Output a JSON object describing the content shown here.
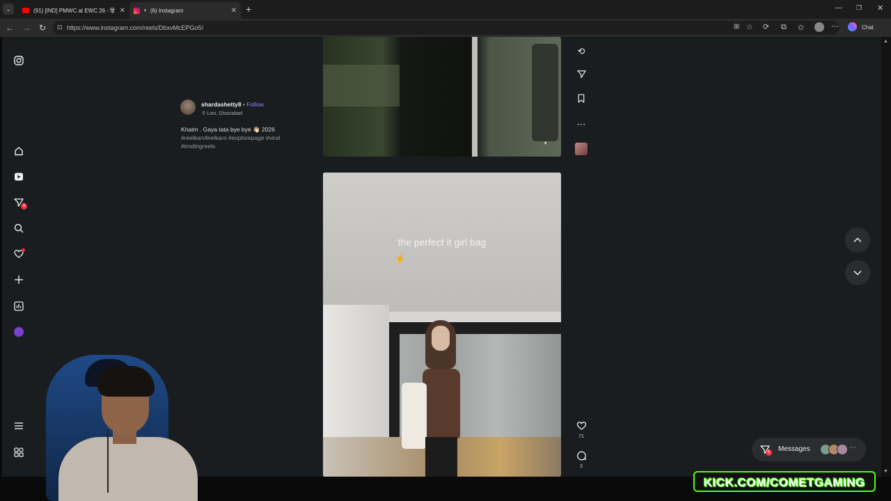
{
  "browser": {
    "tabs": [
      {
        "title": "(91) [IND] PMWC at EWC 26 - हिं",
        "active": false
      },
      {
        "title": "(6) Instagram",
        "active": true
      }
    ],
    "url": "https://www.instagram.com/reels/DbxvMcEPGo5/",
    "chat_label": "Chat"
  },
  "sidebar": {
    "items": [
      {
        "icon": "instagram-logo-icon"
      },
      {
        "icon": "home-icon"
      },
      {
        "icon": "reels-icon"
      },
      {
        "icon": "direct-icon",
        "badge": "6"
      },
      {
        "icon": "search-icon"
      },
      {
        "icon": "notifications-heart-icon"
      },
      {
        "icon": "create-plus-icon"
      },
      {
        "icon": "dashboard-icon"
      },
      {
        "icon": "profile-avatar-icon"
      },
      {
        "icon": "menu-icon"
      },
      {
        "icon": "also-from-meta-icon"
      }
    ]
  },
  "post": {
    "username": "shardashetty8",
    "separator": "•",
    "follow_label": "Follow",
    "location": "Loni, Ghaziabad",
    "caption_line1": "Khatm . Gaya tata bye bye 👋🏻 2026",
    "caption_line2": "#reelkarofeelkaro #explorepage #viral",
    "caption_line3": "#trndingreels"
  },
  "reel2": {
    "overlay_text": "the perfect it girl bag",
    "likes": "71",
    "comments": "3"
  },
  "messages": {
    "label": "Messages",
    "badge": "6"
  },
  "watermark": {
    "text": "KICK.COM/COMETGAMING"
  },
  "colors": {
    "accent_blue": "#8a8fff",
    "badge_red": "#ff3040",
    "watermark_green": "#53fc18"
  }
}
